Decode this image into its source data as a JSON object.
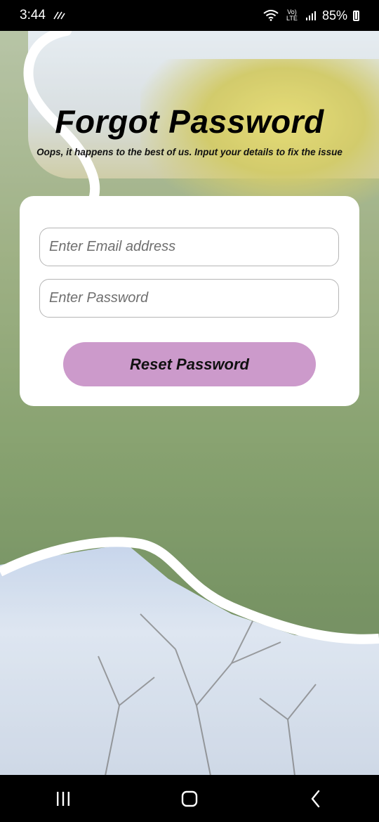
{
  "status_bar": {
    "time": "3:44",
    "carrier_label": "Vo) LTE",
    "battery_percent": "85%"
  },
  "page": {
    "title": "Forgot Password",
    "subtitle": "Oops, it happens to the best of us. Input your details to fix the issue"
  },
  "form": {
    "email_placeholder": "Enter Email address",
    "password_placeholder": "Enter Password",
    "reset_label": "Reset Password"
  },
  "colors": {
    "button": "#cc9acb",
    "card": "#ffffff"
  },
  "nav": {
    "recents_icon": "recents-icon",
    "home_icon": "home-icon",
    "back_icon": "back-icon"
  }
}
